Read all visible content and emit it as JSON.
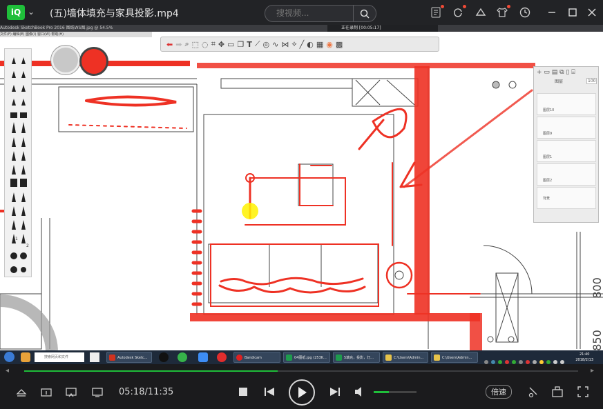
{
  "player": {
    "title": "(五)墙体填充与家具投影.mp4",
    "search_placeholder": "搜视频...",
    "time_current": "05:18",
    "time_total": "11:35",
    "time_separator": "/",
    "speed_label": "倍速",
    "progress_percent": 45.8,
    "volume_percent": 35,
    "accent_color": "#1fbf3a"
  },
  "sketchbook": {
    "window_title": "Autodesk SketchBook Pro 2016   图纸WS图.jpg @ 54.5%",
    "menu": "文件(F)  编辑(E)  图像(I)  窗口(W)  帮助(H)",
    "recording_text": "正在录制 [00:05:17]",
    "layers_title": "图层",
    "layer_opacity": "100",
    "layers": [
      {
        "name": "图层10"
      },
      {
        "name": "图层9"
      },
      {
        "name": "图层1"
      },
      {
        "name": "图层2"
      }
    ],
    "background_label": "背景",
    "dimension_labels": [
      "800",
      "850"
    ],
    "brush_numbers": [
      "1",
      "2"
    ],
    "ink_color": "#ee3124"
  },
  "taskbar": {
    "search_placeholder": "搜索网页和文件",
    "tasks": [
      "Autodesk Sketc...",
      "Bandicam",
      "04图纸.jpg (253K...",
      "5填充，投影，灯...",
      "C:\\Users\\Admin...",
      "C:\\Users\\Admin..."
    ],
    "clock_time": "21:40",
    "clock_date": "2018/2/13"
  }
}
